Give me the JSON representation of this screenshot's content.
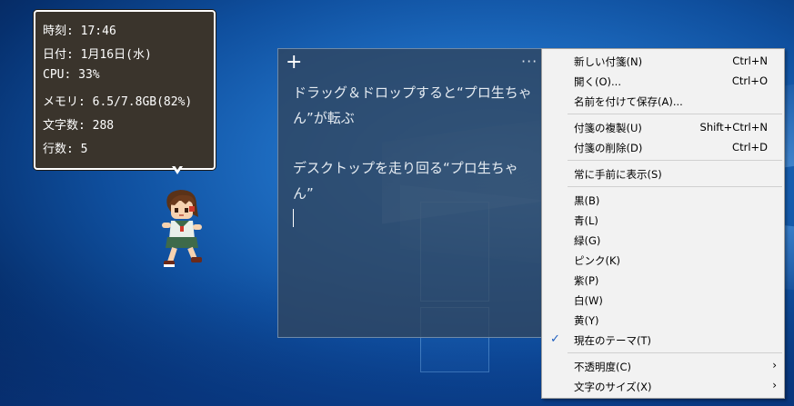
{
  "balloon": {
    "time": "時刻: 17:46",
    "date": "日付: 1月16日(水)",
    "cpu": "CPU: 33%",
    "memory": "メモリ: 6.5/7.8GB(82%)",
    "chars": "文字数: 288",
    "lines": "行数: 5"
  },
  "note": {
    "add_icon": "+",
    "more_icon": "···",
    "lines": [
      "ドラッグ＆ドロップすると“プロ生ちゃ",
      "ん”が転ぶ",
      "デスクトップを走り回る“プロ生ちゃ",
      "ん”"
    ]
  },
  "menu": {
    "items": [
      {
        "label": "新しい付箋(N)",
        "shortcut": "Ctrl+N"
      },
      {
        "label": "開く(O)...",
        "shortcut": "Ctrl+O"
      },
      {
        "label": "名前を付けて保存(A)...",
        "shortcut": ""
      },
      {
        "label": "付箋の複製(U)",
        "shortcut": "Shift+Ctrl+N"
      },
      {
        "label": "付箋の削除(D)",
        "shortcut": "Ctrl+D"
      },
      {
        "label": "常に手前に表示(S)",
        "shortcut": ""
      },
      {
        "label": "黒(B)",
        "shortcut": ""
      },
      {
        "label": "青(L)",
        "shortcut": ""
      },
      {
        "label": "緑(G)",
        "shortcut": ""
      },
      {
        "label": "ピンク(K)",
        "shortcut": ""
      },
      {
        "label": "紫(P)",
        "shortcut": ""
      },
      {
        "label": "白(W)",
        "shortcut": ""
      },
      {
        "label": "黄(Y)",
        "shortcut": ""
      },
      {
        "label": "現在のテーマ(T)",
        "shortcut": "",
        "checked": true
      },
      {
        "label": "不透明度(C)",
        "shortcut": "",
        "submenu": true
      },
      {
        "label": "文字のサイズ(X)",
        "shortcut": "",
        "submenu": true
      }
    ],
    "check_icon": "✓",
    "submenu_icon": "›"
  },
  "colors": {
    "note_bg": "#304660",
    "balloon_bg": "#3a342c",
    "menu_bg": "#f2f2f2",
    "accent": "#1f5fbf"
  }
}
